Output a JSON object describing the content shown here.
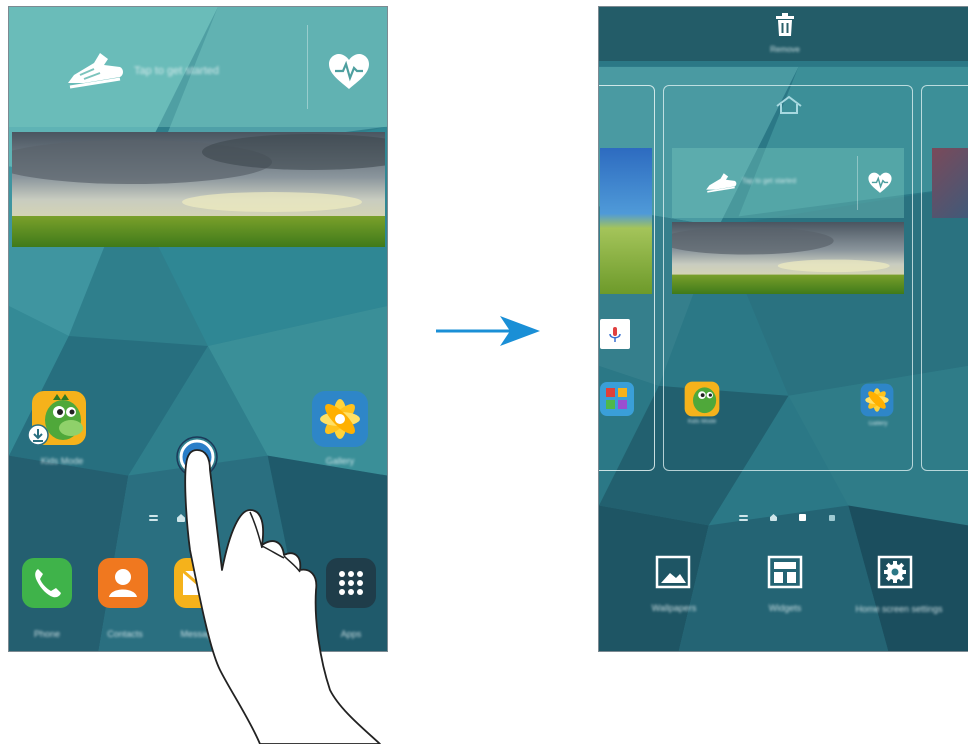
{
  "colors": {
    "wallpaper_base": "#2f7f8c",
    "arrow": "#1a8fd6",
    "trash_bar": "#2a5f68"
  },
  "left_screen": {
    "widget": {
      "icon_left": "running-shoe-icon",
      "label": "Tap to get started",
      "icon_right": "heart-rate-icon"
    },
    "photo_widget": {
      "image": "landscape-photo"
    },
    "apps": [
      {
        "name": "Kids Mode",
        "icon": "dinosaur-icon"
      },
      {
        "name": "Gallery",
        "icon": "gallery-flower-icon"
      }
    ],
    "page_indicator": [
      "menu",
      "home",
      "page",
      "page"
    ],
    "dock": [
      {
        "name": "Phone",
        "icon": "phone-icon"
      },
      {
        "name": "Contacts",
        "icon": "contacts-icon"
      },
      {
        "name": "Messages",
        "icon": "messages-icon"
      },
      {
        "name": "Apps",
        "icon": "apps-grid-icon"
      }
    ],
    "gesture": "pinch-finger"
  },
  "right_screen": {
    "remove_label": "Remove",
    "pages": [
      {
        "apps": [
          "Google",
          "Play Store"
        ]
      },
      {
        "is_home": true,
        "apps": [
          "Kids Mode",
          "Gallery"
        ]
      },
      {
        "apps": []
      }
    ],
    "page_indicator": [
      "menu",
      "home",
      "page",
      "page"
    ],
    "options": [
      {
        "label": "Wallpapers",
        "icon": "wallpaper-icon"
      },
      {
        "label": "Widgets",
        "icon": "widgets-icon"
      },
      {
        "label": "Home screen settings",
        "icon": "settings-gear-icon"
      }
    ]
  }
}
